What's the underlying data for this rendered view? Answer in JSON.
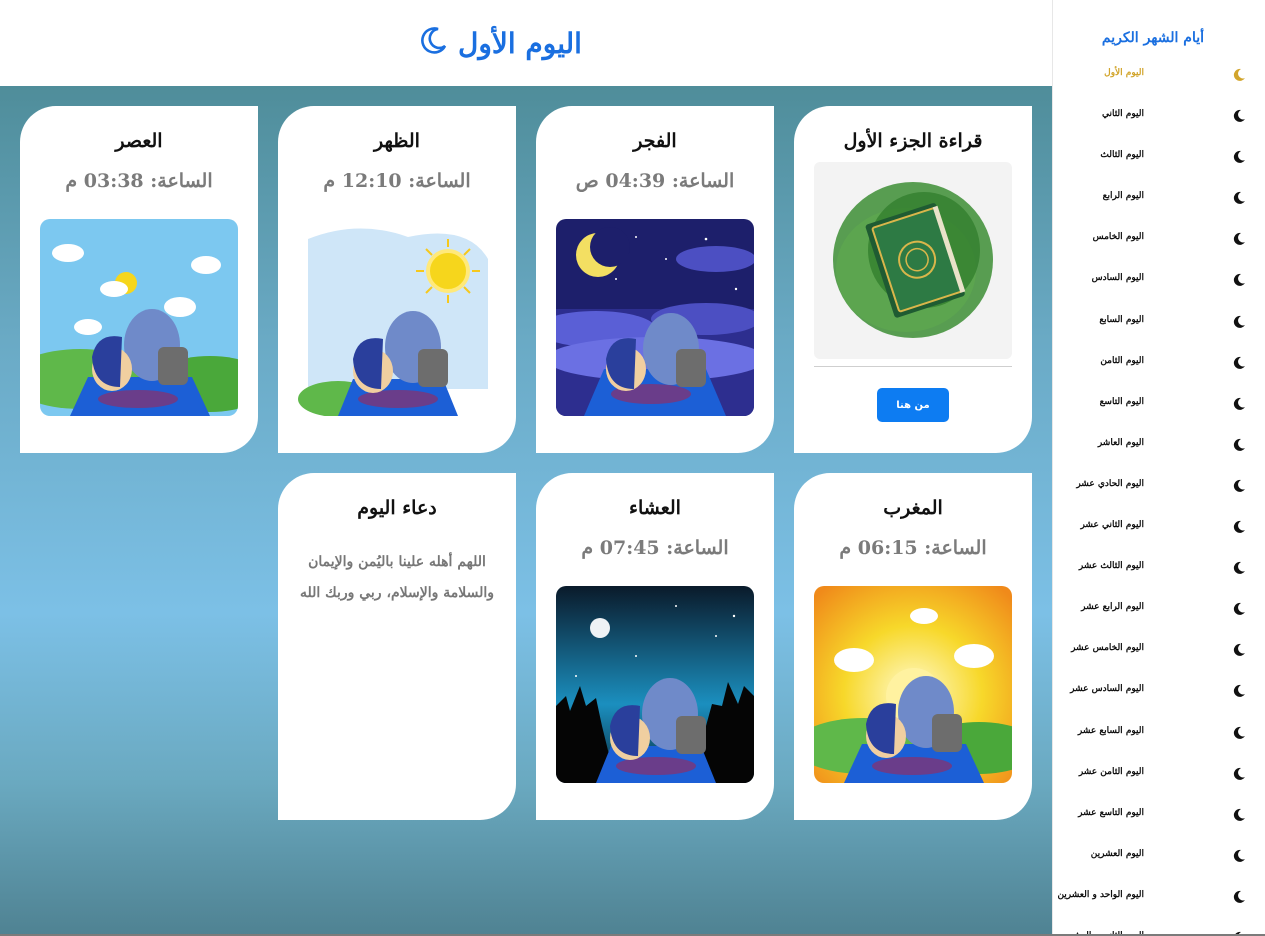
{
  "header": {
    "title": "اليوم الأول",
    "icon": "crescent-moon-icon",
    "accent": "#1a6fe0"
  },
  "cards": {
    "quran": {
      "title": "قراءة الجزء الأول",
      "button": "من هنا"
    },
    "fajr": {
      "title": "الفجر",
      "time": "الساعة: 04:39 ص"
    },
    "dhuhr": {
      "title": "الظهر",
      "time": "الساعة: 12:10 م"
    },
    "asr": {
      "title": "العصر",
      "time": "الساعة: 03:38 م"
    },
    "maghrib": {
      "title": "المغرب",
      "time": "الساعة: 06:15 م"
    },
    "isha": {
      "title": "العشاء",
      "time": "الساعة: 07:45 م"
    },
    "dua": {
      "title": "دعاء اليوم",
      "text": "اللهم أهله علينا باليُمن والإيمان والسلامة والإسلام، ربي وربك الله"
    }
  },
  "sidebar": {
    "title": "أيام الشهر الكريم",
    "active_color": "#d2a52c",
    "items": [
      "اليوم الأول",
      "اليوم الثاني",
      "اليوم الثالث",
      "اليوم الرابع",
      "اليوم الخامس",
      "اليوم السادس",
      "اليوم السابع",
      "اليوم الثامن",
      "اليوم التاسع",
      "اليوم العاشر",
      "اليوم الحادي عشر",
      "اليوم الثاني عشر",
      "اليوم الثالث عشر",
      "اليوم الرابع عشر",
      "اليوم الخامس عشر",
      "اليوم السادس عشر",
      "اليوم السابع عشر",
      "اليوم الثامن عشر",
      "اليوم التاسع عشر",
      "اليوم العشرين",
      "اليوم الواحد و العشرين",
      "اليوم الثاني و العشرين"
    ]
  }
}
